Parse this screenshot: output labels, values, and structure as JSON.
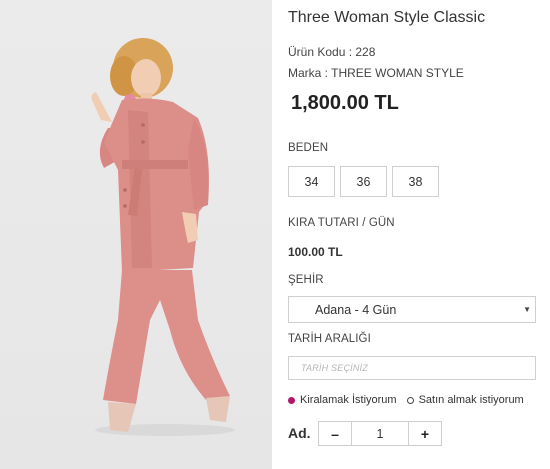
{
  "product": {
    "title": "Three Woman Style Classic",
    "code_label": "Ürün Kodu : 228",
    "brand_label": "Marka : THREE WOMAN STYLE",
    "price": "1,800.00 TL",
    "image_icon": "model-photo"
  },
  "size": {
    "label": "BEDEN",
    "options": [
      "34",
      "36",
      "38"
    ]
  },
  "rent": {
    "label": "KIRA TUTARI / GÜN",
    "value": "100.00 TL"
  },
  "city": {
    "label": "ŞEHİR",
    "selected": "Adana - 4 Gün"
  },
  "date": {
    "label": "TARİH ARALIĞI",
    "placeholder": "TARİH SEÇİNİZ"
  },
  "mode": {
    "rent_option": "Kiralamak İstiyorum",
    "buy_option": "Satın almak istiyorum",
    "selected": "rent",
    "accent_color": "#b0176a"
  },
  "quantity": {
    "label": "Ad.",
    "minus": "–",
    "value": "1",
    "plus": "+"
  }
}
